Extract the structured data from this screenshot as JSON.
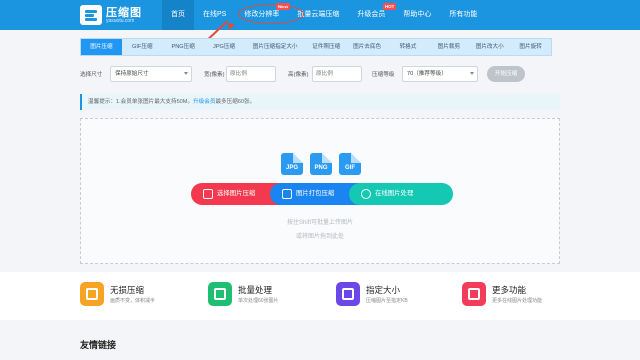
{
  "header": {
    "logo_title": "压缩图",
    "logo_sub": "yasuotu.com",
    "nav": [
      {
        "label": "首页",
        "badge": ""
      },
      {
        "label": "在线PS",
        "badge": ""
      },
      {
        "label": "修改分辨率",
        "badge": "NEW"
      },
      {
        "label": "批量云端压缩",
        "badge": ""
      },
      {
        "label": "升级会员",
        "badge": "HOT"
      },
      {
        "label": "帮助中心",
        "badge": ""
      },
      {
        "label": "所有功能",
        "badge": ""
      }
    ]
  },
  "tabs": [
    "图片压缩",
    "GIF压缩",
    "PNG压缩",
    "JPG压缩",
    "图片压缩指定大小",
    "证件照压缩",
    "图片去底色",
    "转格式",
    "图片裁剪",
    "图片改大小",
    "图片旋转"
  ],
  "options": {
    "size_label": "选择尺寸",
    "size_value": "保持原始尺寸",
    "width_label": "宽(像素)",
    "width_placeholder": "原比例",
    "height_label": "高(像素)",
    "height_placeholder": "原比例",
    "level_label": "压缩等级",
    "level_value": "70（推荐等级）",
    "start_label": "开始压缩"
  },
  "notice": {
    "text": "温馨提示：1.会员单张图片最大支持50M。",
    "link": "升级会员",
    "suffix": "最多压缩60张。"
  },
  "dropzone": {
    "formats": [
      "JPG",
      "PNG",
      "GIF"
    ],
    "btn_select": "选择图片压缩",
    "btn_zip": "图片打包压缩",
    "btn_online": "在线图片处理",
    "hint1": "按住Shift可批量上传图片",
    "hint2": "或将图片拖到此处"
  },
  "features": [
    {
      "title": "无损压缩",
      "desc": "画质不变，体积减半",
      "color": "#f7a425"
    },
    {
      "title": "批量处理",
      "desc": "单次处理60张图片",
      "color": "#1fbf73"
    },
    {
      "title": "指定大小",
      "desc": "压缩图片至指定KB",
      "color": "#6b46e8"
    },
    {
      "title": "更多功能",
      "desc": "更多在线图片处理功能",
      "color": "#f23c5a"
    }
  ],
  "links_title": "友情链接"
}
